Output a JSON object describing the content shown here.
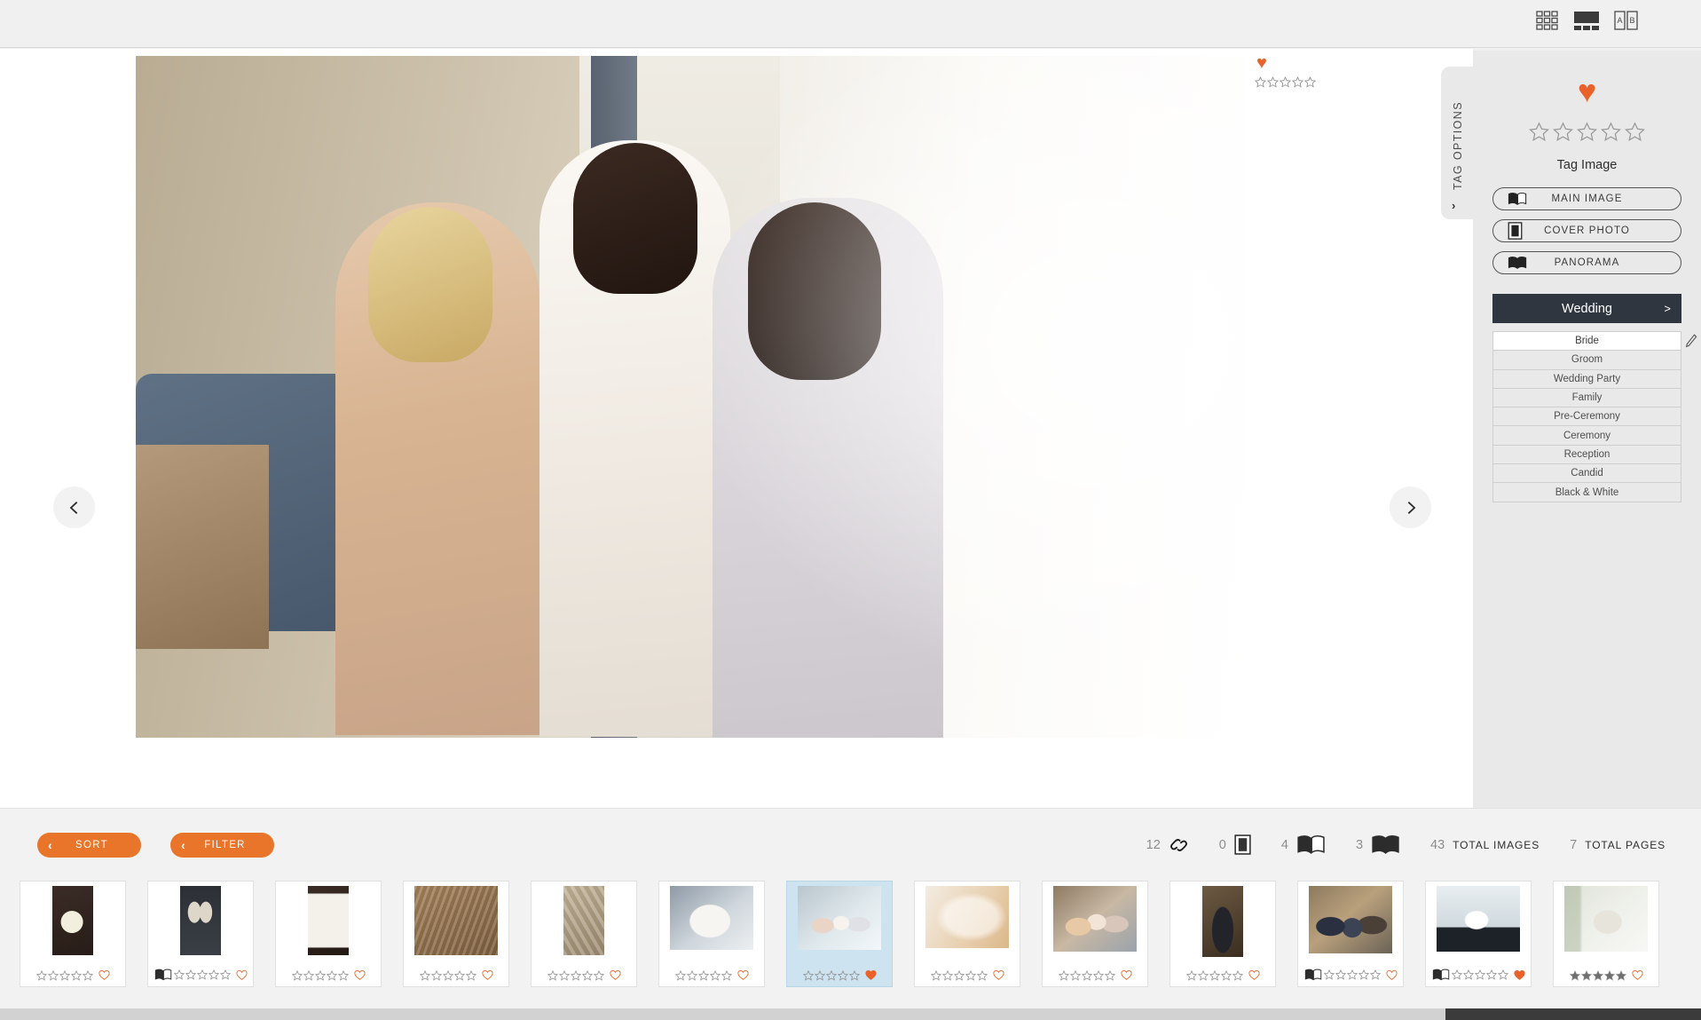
{
  "app": {
    "accent_orange": "#e8752a",
    "heart_orange": "#e8622a",
    "dark_header": "#2f3640",
    "selected_thumb": "#cde3ef"
  },
  "topbar": {
    "view_toggles": [
      {
        "name": "grid-view-toggle",
        "label": "Grid View"
      },
      {
        "name": "single-view-toggle",
        "label": "Single View"
      },
      {
        "name": "spread-view-toggle",
        "label": "A B Spread View"
      }
    ]
  },
  "viewer": {
    "prev_label": "‹",
    "next_label": "›",
    "favorite_heart": "♥",
    "star_rating": 0,
    "star_total": 5,
    "zoom_icon": "search-icon",
    "zoom_value": 0
  },
  "tag_panel": {
    "tab_label": "TAG OPTIONS",
    "tab_chevron": "›",
    "heart": "♥",
    "rating": 0,
    "star_total": 5,
    "tag_image_label": "Tag Image",
    "buttons": [
      {
        "label": "MAIN IMAGE",
        "icon": "open-book-icon"
      },
      {
        "label": "COVER PHOTO",
        "icon": "cover-photo-icon"
      },
      {
        "label": "PANORAMA",
        "icon": "panorama-book-icon"
      }
    ],
    "category": {
      "label": "Wedding",
      "arrow": ">"
    },
    "tags": [
      {
        "label": "Bride",
        "active": true
      },
      {
        "label": "Groom",
        "active": false
      },
      {
        "label": "Wedding Party",
        "active": false
      },
      {
        "label": "Family",
        "active": false
      },
      {
        "label": "Pre-Ceremony",
        "active": false
      },
      {
        "label": "Ceremony",
        "active": false
      },
      {
        "label": "Reception",
        "active": false
      },
      {
        "label": "Candid",
        "active": false
      },
      {
        "label": "Black & White",
        "active": false
      }
    ],
    "edit_icon": "pencil-icon"
  },
  "toolbar": {
    "sort": {
      "label": "SORT",
      "chevron": "‹"
    },
    "filter": {
      "label": "FILTER",
      "chevron": "‹"
    },
    "counters": [
      {
        "name": "linked-images-count",
        "value": "12",
        "icon": "link-icon",
        "label": ""
      },
      {
        "name": "cover-photo-count",
        "value": "0",
        "icon": "cover-photo-icon",
        "label": ""
      },
      {
        "name": "main-image-count",
        "value": "4",
        "icon": "open-book-icon",
        "label": ""
      },
      {
        "name": "panorama-count",
        "value": "3",
        "icon": "panorama-book-icon",
        "label": ""
      },
      {
        "name": "total-images-count",
        "value": "43",
        "icon": "",
        "label": "TOTAL IMAGES"
      },
      {
        "name": "total-pages-count",
        "value": "7",
        "icon": "",
        "label": "TOTAL PAGES"
      }
    ]
  },
  "filmstrip": {
    "thumbnails": [
      {
        "id": 1,
        "alt": "boutonniere on dark background",
        "rating": 0,
        "favorite": false,
        "book": false,
        "selected": false,
        "orientation": "portrait"
      },
      {
        "id": 2,
        "alt": "sparkly bridal heels",
        "rating": 0,
        "favorite": false,
        "book": true,
        "selected": false,
        "orientation": "portrait"
      },
      {
        "id": 3,
        "alt": "wedding invitation with ribbon",
        "rating": 0,
        "favorite": false,
        "book": false,
        "selected": false,
        "orientation": "portrait"
      },
      {
        "id": 4,
        "alt": "basket of favors",
        "rating": 0,
        "favorite": false,
        "book": false,
        "selected": false,
        "orientation": "landscape"
      },
      {
        "id": 5,
        "alt": "favors on fabric",
        "rating": 0,
        "favorite": false,
        "book": false,
        "selected": false,
        "orientation": "portrait"
      },
      {
        "id": 6,
        "alt": "bride in robe by window",
        "rating": 0,
        "favorite": false,
        "book": false,
        "selected": false,
        "orientation": "landscape"
      },
      {
        "id": 7,
        "alt": "bride with mother and bridesmaid",
        "rating": 0,
        "favorite": true,
        "book": false,
        "selected": true,
        "orientation": "landscape"
      },
      {
        "id": 8,
        "alt": "hands fastening dress",
        "rating": 0,
        "favorite": false,
        "book": false,
        "selected": false,
        "orientation": "landscape"
      },
      {
        "id": 9,
        "alt": "bride hugging friends",
        "rating": 0,
        "favorite": false,
        "book": false,
        "selected": false,
        "orientation": "landscape"
      },
      {
        "id": 10,
        "alt": "groom in tuxedo",
        "rating": 0,
        "favorite": false,
        "book": false,
        "selected": false,
        "orientation": "portrait"
      },
      {
        "id": 11,
        "alt": "groom with parents",
        "rating": 0,
        "favorite": false,
        "book": true,
        "selected": false,
        "orientation": "landscape"
      },
      {
        "id": 12,
        "alt": "ceremony in glass atrium",
        "rating": 0,
        "favorite": true,
        "book": true,
        "selected": false,
        "orientation": "landscape"
      },
      {
        "id": 13,
        "alt": "bride by window back of dress",
        "rating": 5,
        "favorite": false,
        "book": false,
        "selected": false,
        "orientation": "landscape"
      }
    ]
  }
}
